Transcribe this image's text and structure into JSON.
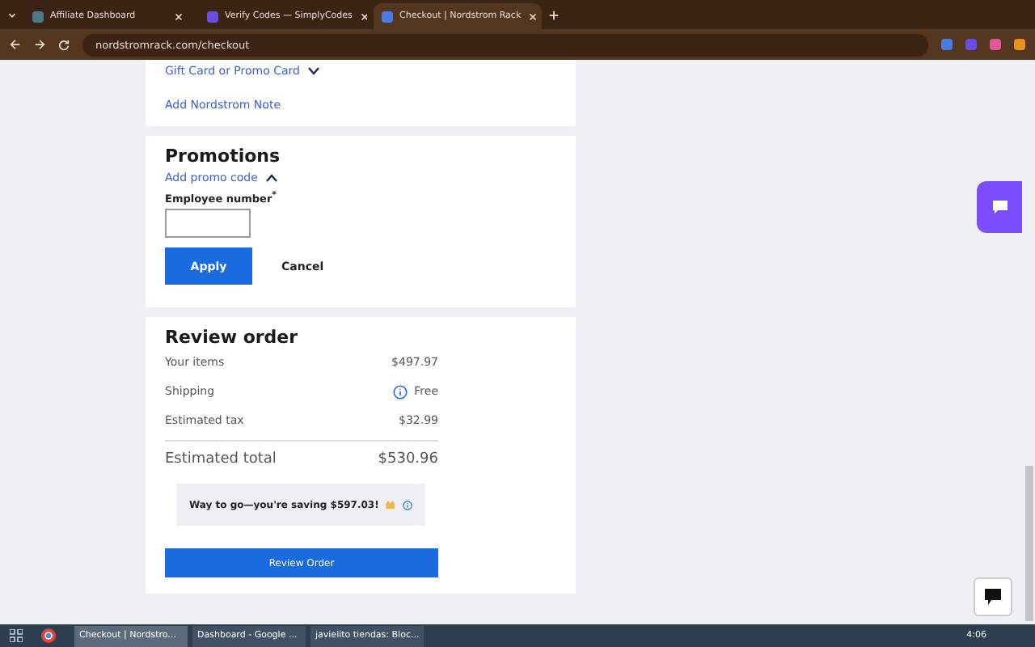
{
  "browser": {
    "tabs": [
      {
        "title": "Affiliate Dashboard",
        "selected": false
      },
      {
        "title": "Verify Codes — SimplyCodes",
        "selected": false
      },
      {
        "title": "Checkout | Nordstrom Rack",
        "selected": true
      }
    ],
    "address": "nordstromrack.com/checkout"
  },
  "payment": {
    "links": [
      {
        "label": "Gift Card or Promo Card",
        "expanded": false
      },
      {
        "label": "Add Nordstrom Note"
      }
    ]
  },
  "promotions": {
    "title": "Promotions",
    "link": {
      "label": "Add promo code",
      "expanded": true
    },
    "field_label": "Employee number",
    "required_mark": "*",
    "apply": "Apply",
    "cancel": "Cancel"
  },
  "review": {
    "title": "Review order",
    "rows": [
      {
        "label": "Your items",
        "value": "$497.97",
        "info": false
      },
      {
        "label": "Shipping",
        "value": "Free",
        "info": true
      },
      {
        "label": "Estimated tax",
        "value": "$32.99",
        "info": false
      }
    ],
    "total_label": "Estimated total",
    "total_value": "$530.96",
    "savings": "Way to go—you're saving $597.03!",
    "button": "Review Order"
  },
  "taskbar": {
    "items": [
      {
        "label": "Checkout | Nordstro...",
        "selected": true
      },
      {
        "label": "Dashboard - Google ...",
        "selected": false
      },
      {
        "label": "javielito tiendas: Bloc...",
        "selected": false
      }
    ],
    "time": "4:06"
  }
}
